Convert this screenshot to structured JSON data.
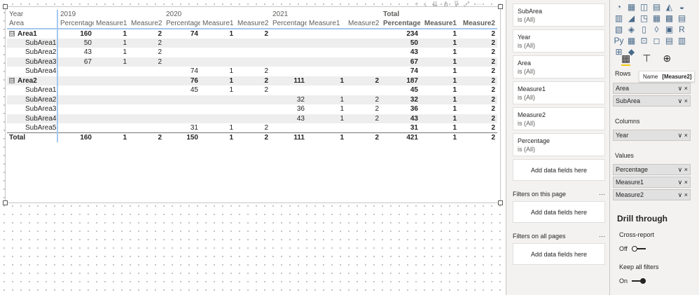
{
  "matrix": {
    "header": {
      "row1": [
        "Year",
        "2019",
        "",
        "",
        "2020",
        "",
        "",
        "2021",
        "",
        "",
        "Total",
        "",
        ""
      ],
      "row2": [
        "Area",
        "Percentage",
        "Measure1",
        "Measure2",
        "Percentage",
        "Measure1",
        "Measure2",
        "Percentage",
        "Measure1",
        "Measure2",
        "Percentage",
        "Measure1",
        "Measure2"
      ]
    },
    "rows": [
      {
        "type": "group",
        "label": "Area1",
        "cells": [
          "160",
          "1",
          "2",
          "74",
          "1",
          "2",
          "",
          "",
          "",
          "234",
          "1",
          "2"
        ]
      },
      {
        "type": "sub",
        "label": "SubArea1",
        "cells": [
          "50",
          "1",
          "2",
          "",
          "",
          "",
          "",
          "",
          "",
          "50",
          "1",
          "2"
        ]
      },
      {
        "type": "sub",
        "label": "SubArea2",
        "cells": [
          "43",
          "1",
          "2",
          "",
          "",
          "",
          "",
          "",
          "",
          "43",
          "1",
          "2"
        ]
      },
      {
        "type": "sub",
        "label": "SubArea3",
        "cells": [
          "67",
          "1",
          "2",
          "",
          "",
          "",
          "",
          "",
          "",
          "67",
          "1",
          "2"
        ]
      },
      {
        "type": "sub",
        "label": "SubArea4",
        "cells": [
          "",
          "",
          "",
          "74",
          "1",
          "2",
          "",
          "",
          "",
          "74",
          "1",
          "2"
        ]
      },
      {
        "type": "group",
        "label": "Area2",
        "cells": [
          "",
          "",
          "",
          "76",
          "1",
          "2",
          "111",
          "1",
          "2",
          "187",
          "1",
          "2"
        ]
      },
      {
        "type": "sub",
        "label": "SubArea1",
        "cells": [
          "",
          "",
          "",
          "45",
          "1",
          "2",
          "",
          "",
          "",
          "45",
          "1",
          "2"
        ]
      },
      {
        "type": "sub",
        "label": "SubArea2",
        "cells": [
          "",
          "",
          "",
          "",
          "",
          "",
          "32",
          "1",
          "2",
          "32",
          "1",
          "2"
        ]
      },
      {
        "type": "sub",
        "label": "SubArea3",
        "cells": [
          "",
          "",
          "",
          "",
          "",
          "",
          "36",
          "1",
          "2",
          "36",
          "1",
          "2"
        ]
      },
      {
        "type": "sub",
        "label": "SubArea4",
        "cells": [
          "",
          "",
          "",
          "",
          "",
          "",
          "43",
          "1",
          "2",
          "43",
          "1",
          "2"
        ]
      },
      {
        "type": "sub",
        "label": "SubArea5",
        "cells": [
          "",
          "",
          "",
          "31",
          "1",
          "2",
          "",
          "",
          "",
          "31",
          "1",
          "2"
        ]
      }
    ],
    "total": {
      "label": "Total",
      "cells": [
        "160",
        "1",
        "2",
        "150",
        "1",
        "2",
        "111",
        "1",
        "2",
        "421",
        "1",
        "2"
      ]
    },
    "expand_glyph": "⊟"
  },
  "visual_header_icons": [
    "↑",
    "↓",
    "⇊",
    "⋔",
    "⊽",
    "⤢",
    "⋯"
  ],
  "filters": {
    "cards": [
      {
        "title": "SubArea",
        "state": "is (All)"
      },
      {
        "title": "Year",
        "state": "is (All)"
      },
      {
        "title": "Area",
        "state": "is (All)"
      },
      {
        "title": "Measure1",
        "state": "is (All)"
      },
      {
        "title": "Measure2",
        "state": "is (All)"
      },
      {
        "title": "Percentage",
        "state": "is (All)"
      }
    ],
    "add_label": "Add data fields here",
    "on_this_page": "Filters on this page",
    "on_all_pages": "Filters on all pages",
    "more": "···"
  },
  "viz_icons": [
    "◔",
    "▦",
    "◫",
    "▤",
    "◭",
    "◒",
    "▥",
    "◢",
    "◳",
    "▦",
    "▩",
    "▤",
    "▧",
    "◈",
    "▯",
    "◊",
    "▣",
    "R",
    "Py",
    "▦",
    "⊡",
    "◻",
    "▤",
    "▥",
    "⊞",
    "◆"
  ],
  "tabs": {
    "fields_icon": "▦",
    "format_icon": "⊤",
    "analytics_icon": "⊕"
  },
  "wells": {
    "rows_label": "Rows",
    "rows": [
      "Area",
      "SubArea"
    ],
    "columns_label": "Columns",
    "columns": [
      "Year"
    ],
    "values_label": "Values",
    "values": [
      "Percentage",
      "Measure1",
      "Measure2"
    ],
    "chev": "∨ ×"
  },
  "tooltip": {
    "name": "Name",
    "value": "[Measure2]"
  },
  "drill": {
    "title": "Drill through",
    "cross_report": "Cross-report",
    "cross_state": "Off",
    "keep_filters": "Keep all filters",
    "keep_state": "On"
  }
}
